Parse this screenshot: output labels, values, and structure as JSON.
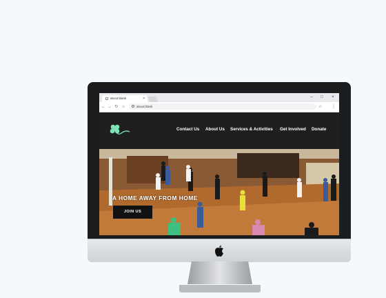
{
  "browser": {
    "tab_title": "about:blank",
    "tab_close": "×",
    "url": "about:blank",
    "window_controls": {
      "minimize": "–",
      "maximize": "□",
      "close": "×"
    },
    "nav": {
      "back": "←",
      "forward": "→",
      "reload": "↻",
      "home": "⌂"
    },
    "star": "☆",
    "menu": "⋮"
  },
  "site": {
    "logo_icon": "clover-icon",
    "nav_items": [
      "Contact Us",
      "About Us",
      "Services & Activities",
      "Get Involved",
      "Donate"
    ],
    "hero": {
      "title": "A HOME AWAY FROM HOME",
      "button_label": "JOIN US"
    }
  },
  "colors": {
    "header_bg": "#1f1f20",
    "logo_green": "#7fe3b4",
    "hero_floor": "#b06a2e"
  }
}
